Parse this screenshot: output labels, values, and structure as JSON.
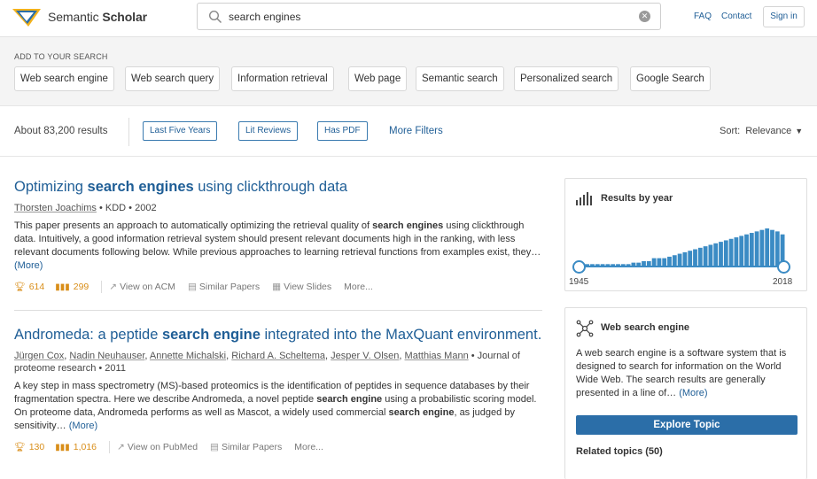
{
  "header": {
    "logo_name_light": "Semantic",
    "logo_name_bold": "Scholar",
    "search_value": "search engines",
    "faq": "FAQ",
    "contact": "Contact",
    "signin": "Sign in"
  },
  "suggest": {
    "title": "ADD TO YOUR SEARCH",
    "chips": [
      "Web search engine",
      "Web search query",
      "Information retrieval",
      "Web page",
      "Semantic search",
      "Personalized search",
      "Google Search"
    ]
  },
  "filters": {
    "count": "About 83,200 results",
    "buttons": [
      "Last Five Years",
      "Lit Reviews",
      "Has PDF"
    ],
    "more_filters": "More Filters",
    "sort_label": "Sort:",
    "sort_value": "Relevance"
  },
  "results": [
    {
      "title_pre": "Optimizing ",
      "title_bold": "search engines",
      "title_post": " using clickthrough data",
      "authors": [
        "Thorsten Joachims"
      ],
      "venue": " • KDD • 2002",
      "abstract_pre": "This paper presents an approach to automatically optimizing the retrieval quality of ",
      "abstract_bold": "search engines",
      "abstract_post": " using clickthrough data. Intuitively, a good information retrieval system should present relevant documents high in the ranking, with less relevant documents following below. While previous approaches to learning retrieval functions from examples exist, they…",
      "more": "(More)",
      "influential": "614",
      "citations": "299",
      "actions": [
        "View on ACM",
        "Similar Papers",
        "View Slides",
        "More..."
      ]
    },
    {
      "title_pre": "Andromeda: a peptide ",
      "title_bold": "search engine",
      "title_post": " integrated into the MaxQuant environment.",
      "authors": [
        "Jürgen Cox",
        "Nadin Neuhauser",
        "Annette Michalski",
        "Richard A. Scheltema",
        "Jesper V. Olsen",
        "Matthias Mann"
      ],
      "venue": " • Journal of proteome research • 2011",
      "abstract_pre": "A key step in mass spectrometry (MS)-based proteomics is the identification of peptides in sequence databases by their fragmentation spectra. Here we describe Andromeda, a novel peptide ",
      "abstract_bold": "search engine",
      "abstract_mid": " using a probabilistic scoring model. On proteome data, Andromeda performs as well as Mascot, a widely used commercial ",
      "abstract_bold2": "search engine",
      "abstract_post": ", as judged by sensitivity…",
      "more": "(More)",
      "influential": "130",
      "citations": "1,016",
      "actions": [
        "View on PubMed",
        "Similar Papers",
        "More..."
      ]
    }
  ],
  "by_year": {
    "title": "Results by year",
    "start_year": "1945",
    "end_year": "2018",
    "counts": [
      1,
      1,
      1,
      1,
      1,
      1,
      1,
      1,
      1,
      1,
      2,
      2,
      3,
      3,
      5,
      5,
      5,
      6,
      7,
      8,
      9,
      10,
      11,
      12,
      13,
      14,
      15,
      16,
      17,
      18,
      19,
      20,
      21,
      22,
      23,
      24,
      25,
      24,
      23,
      21
    ]
  },
  "topic": {
    "title": "Web search engine",
    "description": "A web search engine is a software system that is designed to search for information on the World Wide Web. The search results are generally presented in a line of…",
    "more": "(More)",
    "explore": "Explore Topic",
    "related": "Related topics (50)"
  },
  "colors": {
    "link": "#1f5e96",
    "accent": "#3b8bc4",
    "stat": "#d98e19",
    "button": "#2b6ea8"
  }
}
